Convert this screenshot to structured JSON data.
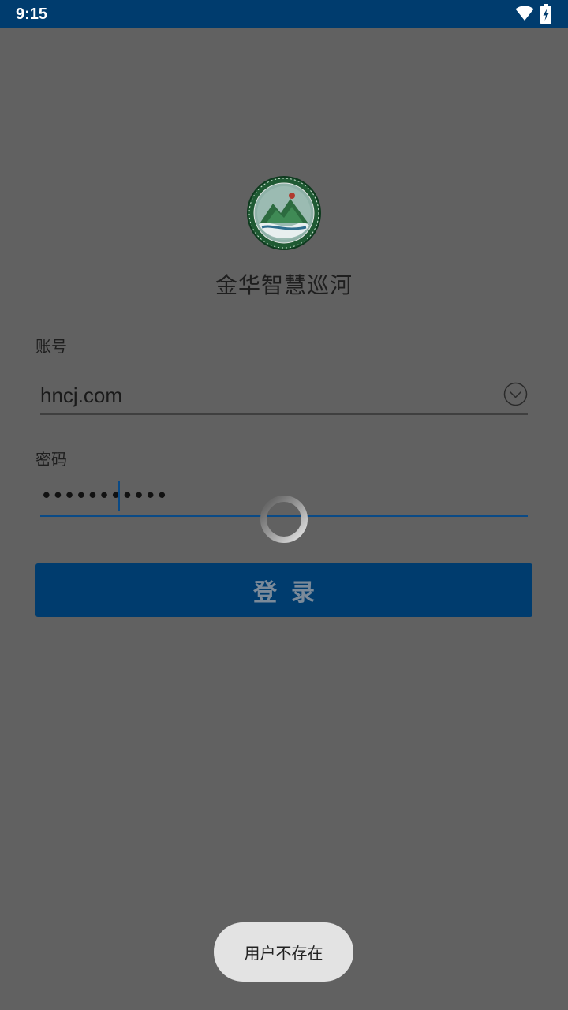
{
  "status_bar": {
    "time": "9:15",
    "icons": [
      "wifi-icon",
      "battery-charging-icon"
    ],
    "background_color": "#003c6e"
  },
  "app": {
    "logo_icon": "jinhua-river-logo",
    "title": "金华智慧巡河"
  },
  "login_form": {
    "account_label": "账号",
    "account_value": "hncj.com",
    "account_dropdown_icon": "chevron-down-circle-icon",
    "password_label": "密码",
    "password_value": "•••••••••••",
    "login_button_label": "登录",
    "accent_color": "#003c6e"
  },
  "loading": {
    "icon": "loading-spinner-icon"
  },
  "toast": {
    "message": "用户不存在"
  },
  "overlay_color": "#616161"
}
